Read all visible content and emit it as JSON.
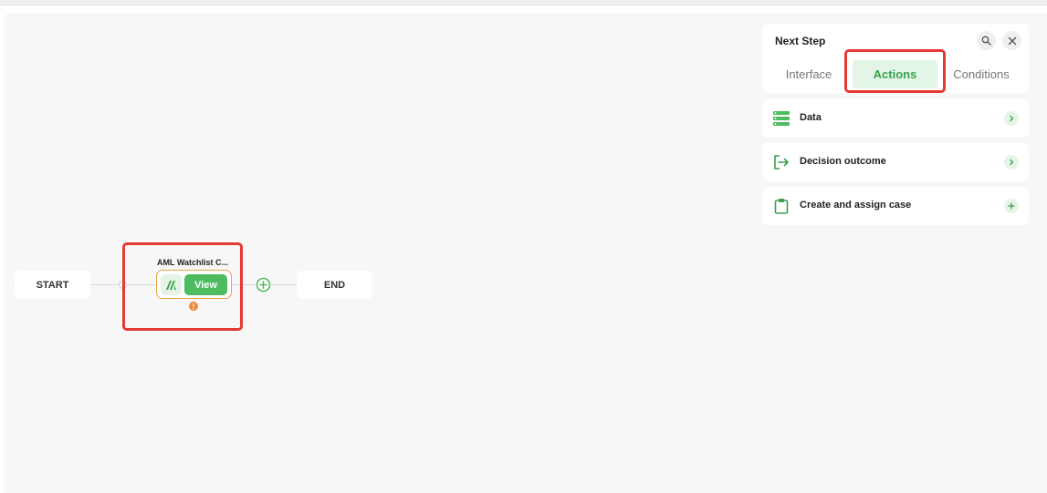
{
  "flow": {
    "start_label": "START",
    "end_label": "END",
    "step": {
      "title": "AML Watchlist C...",
      "view_label": "View",
      "warning_glyph": "!"
    }
  },
  "panel": {
    "title": "Next Step",
    "tabs": [
      {
        "label": "Interface",
        "active": false
      },
      {
        "label": "Actions",
        "active": true
      },
      {
        "label": "Conditions",
        "active": false
      }
    ],
    "items": [
      {
        "label": "Data",
        "icon": "database-icon",
        "trailing": "chevron-right-icon"
      },
      {
        "label": "Decision outcome",
        "icon": "exit-arrow-icon",
        "trailing": "chevron-right-icon"
      },
      {
        "label": "Create and assign case",
        "icon": "clipboard-icon",
        "trailing": "plus-icon"
      }
    ]
  },
  "colors": {
    "accent": "#4cbc5f",
    "accent_light": "#e3f5e6",
    "warning": "#ef8a3c",
    "highlight": "#e53935"
  }
}
